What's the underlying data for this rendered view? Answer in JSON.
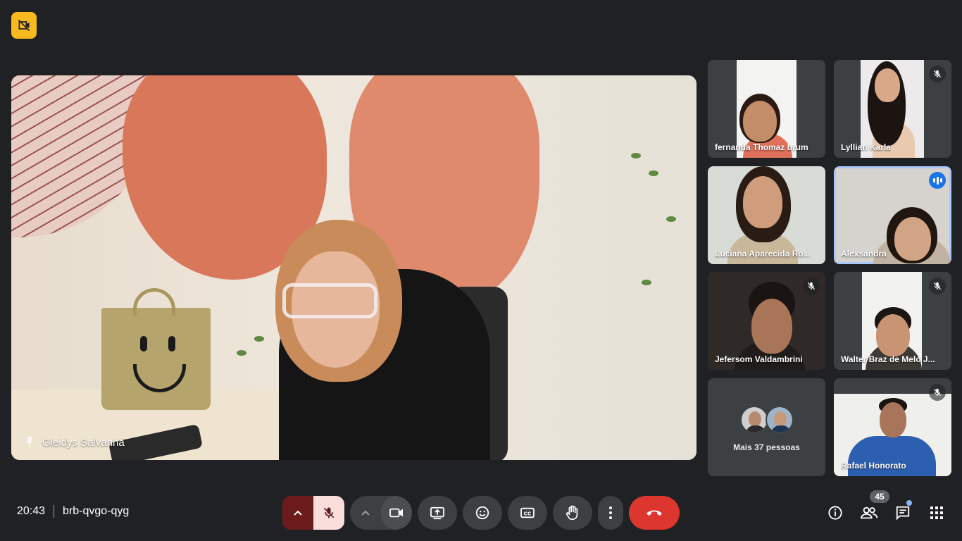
{
  "meeting": {
    "time": "20:43",
    "code": "brb-qvgo-qyg"
  },
  "main_speaker": {
    "name": "Gleidys Salvanha",
    "pinned": true
  },
  "participants": [
    {
      "name": "fernanda Thomaz brum",
      "muted": false,
      "speaking": false
    },
    {
      "name": "Lyllian Karla",
      "muted": true,
      "speaking": false
    },
    {
      "name": "Luciana Aparecida Ro...",
      "muted": false,
      "speaking": false
    },
    {
      "name": "Alexsandra",
      "muted": false,
      "speaking": true
    },
    {
      "name": "Jefersom Valdambrini",
      "muted": true,
      "speaking": false
    },
    {
      "name": "Walter Braz de Melo J...",
      "muted": true,
      "speaking": false
    },
    {
      "name": "Rafael Honorato",
      "muted": true,
      "speaking": false
    }
  ],
  "more_people": {
    "label": "Mais 37 pessoas"
  },
  "toolbar": {
    "participant_count": "45",
    "icons": {
      "mic": "mic-off-icon",
      "camera": "videocam-icon",
      "present": "present-screen-icon",
      "reactions": "emoji-icon",
      "captions": "closed-captions-icon",
      "raise_hand": "raise-hand-icon",
      "more": "more-vert-icon",
      "end_call": "call-end-icon",
      "info": "info-icon",
      "people": "people-icon",
      "chat": "chat-icon",
      "activities": "apps-grid-icon"
    }
  },
  "colors": {
    "background": "#202124",
    "tile": "#3c4043",
    "end_call": "#dc362e",
    "active_border": "#a8c7fa",
    "badge": "#f9ba1f"
  }
}
